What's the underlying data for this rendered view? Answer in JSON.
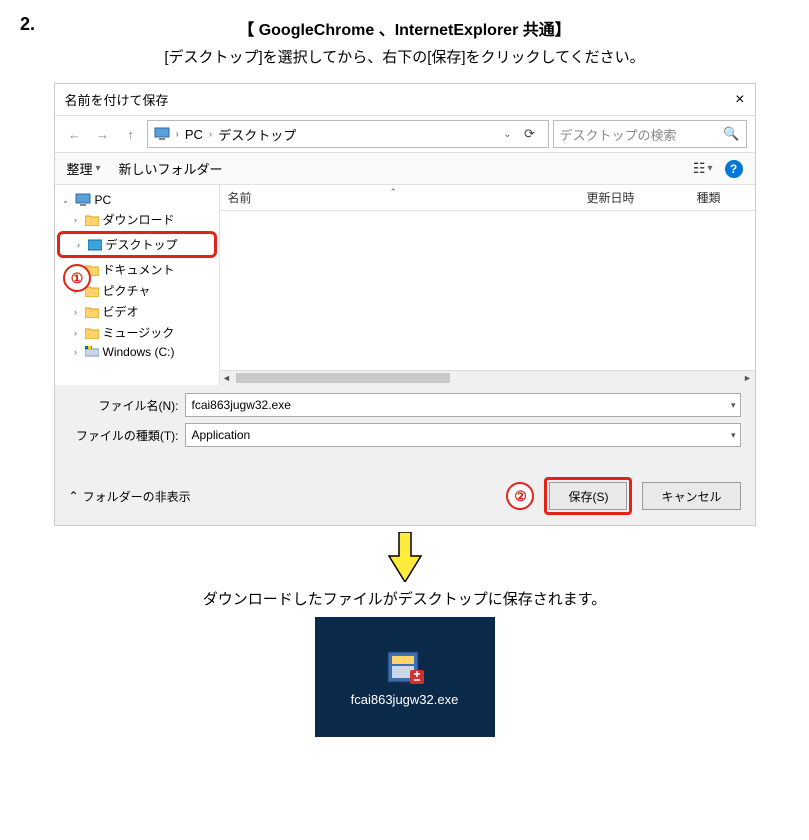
{
  "step_number": "2.",
  "title": "【 GoogleChrome 、InternetExplorer 共通】",
  "instruction": "[デスクトップ]を選択してから、右下の[保存]をクリックしてください。",
  "dialog": {
    "title": "名前を付けて保存",
    "path": {
      "root": "PC",
      "folder": "デスクトップ"
    },
    "search_placeholder": "デスクトップの検索",
    "toolbar": {
      "organize": "整理",
      "new_folder": "新しいフォルダー"
    },
    "columns": {
      "name": "名前",
      "date": "更新日時",
      "type": "種類"
    },
    "tree": {
      "root": "PC",
      "items": [
        "ダウンロード",
        "デスクトップ",
        "ドキュメント",
        "ピクチャ",
        "ビデオ",
        "ミュージック",
        "Windows (C:)"
      ]
    },
    "filename_label": "ファイル名(N):",
    "filename_value": "fcai863jugw32.exe",
    "filetype_label": "ファイルの種類(T):",
    "filetype_value": "Application",
    "hide_folders": "フォルダーの非表示",
    "save_btn": "保存(S)",
    "cancel_btn": "キャンセル"
  },
  "callouts": {
    "one": "①",
    "two": "②"
  },
  "result_text": "ダウンロードしたファイルがデスクトップに保存されます。",
  "desktop_file": "fcai863jugw32.exe"
}
